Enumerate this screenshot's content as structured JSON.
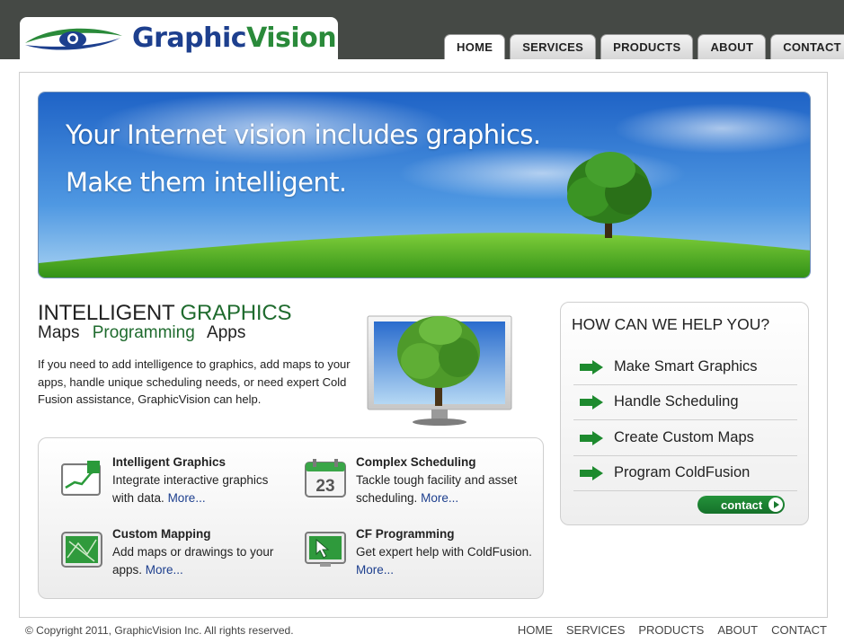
{
  "brand": {
    "name_part1": "Graphic",
    "name_part2": "Vision"
  },
  "nav": {
    "tabs": [
      {
        "label": "HOME",
        "active": true
      },
      {
        "label": "SERVICES",
        "active": false
      },
      {
        "label": "PRODUCTS",
        "active": false
      },
      {
        "label": "ABOUT",
        "active": false
      },
      {
        "label": "CONTACT",
        "active": false
      }
    ]
  },
  "hero": {
    "line1": "Your Internet vision includes graphics.",
    "line2": "Make them intelligent."
  },
  "intro": {
    "title_part1": "INTELLIGENT",
    "title_part2": "GRAPHICS",
    "sub": [
      "Maps",
      "Programming",
      "Apps"
    ],
    "body": "If you need to add intelligence to graphics, add maps to your apps, handle unique scheduling needs, or need expert Cold Fusion assistance, GraphicVision can help."
  },
  "features": [
    {
      "title": "Intelligent Graphics",
      "desc": "Integrate interactive graphics with data.",
      "more": "More...",
      "icon": "chart-icon"
    },
    {
      "title": "Complex Scheduling",
      "desc": "Tackle tough facility and asset scheduling.",
      "more": "More...",
      "icon": "calendar-icon",
      "calendar_number": "23"
    },
    {
      "title": "Custom Mapping",
      "desc": "Add maps or drawings to your apps.",
      "more": "More...",
      "icon": "map-icon"
    },
    {
      "title": "CF Programming",
      "desc": "Get expert help with ColdFusion.",
      "more": "More...",
      "icon": "cursor-icon"
    }
  ],
  "help": {
    "title": "HOW CAN WE HELP YOU?",
    "items": [
      {
        "label": "Make Smart Graphics"
      },
      {
        "label": "Handle Scheduling"
      },
      {
        "label": "Create Custom Maps"
      },
      {
        "label": "Program ColdFusion"
      }
    ],
    "contact_label": "contact"
  },
  "footer": {
    "copyright": "© Copyright 2011, GraphicVision Inc. All rights reserved.",
    "links": [
      "HOME",
      "SERVICES",
      "PRODUCTS",
      "ABOUT",
      "CONTACT"
    ]
  },
  "colors": {
    "topbar": "#454945",
    "brand_blue": "#1d3f8e",
    "brand_green": "#2a8a3a",
    "accent_green": "#1f6b2e"
  }
}
